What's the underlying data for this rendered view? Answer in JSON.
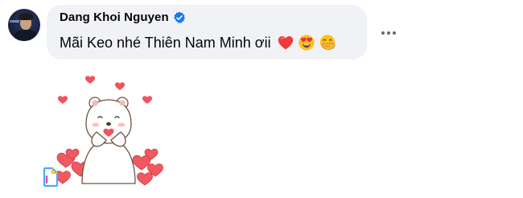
{
  "comment": {
    "author": "Dang Khoi Nguyen",
    "verified": true,
    "text": "Mãi Keo nhé Thiên Nam Minh ơii",
    "emojis": [
      "red-heart-emoji",
      "heart-eyes-emoji",
      "face-with-hand-over-mouth-emoji"
    ]
  },
  "actions": {
    "more_icon": "more-horizontal-icon"
  },
  "sticker": {
    "name": "bear-hearts-sticker"
  },
  "colors": {
    "bubble": "#f0f2f5",
    "text": "#050505",
    "verified": "#1877f2",
    "muted": "#65676b",
    "heart": "#f4525d"
  }
}
